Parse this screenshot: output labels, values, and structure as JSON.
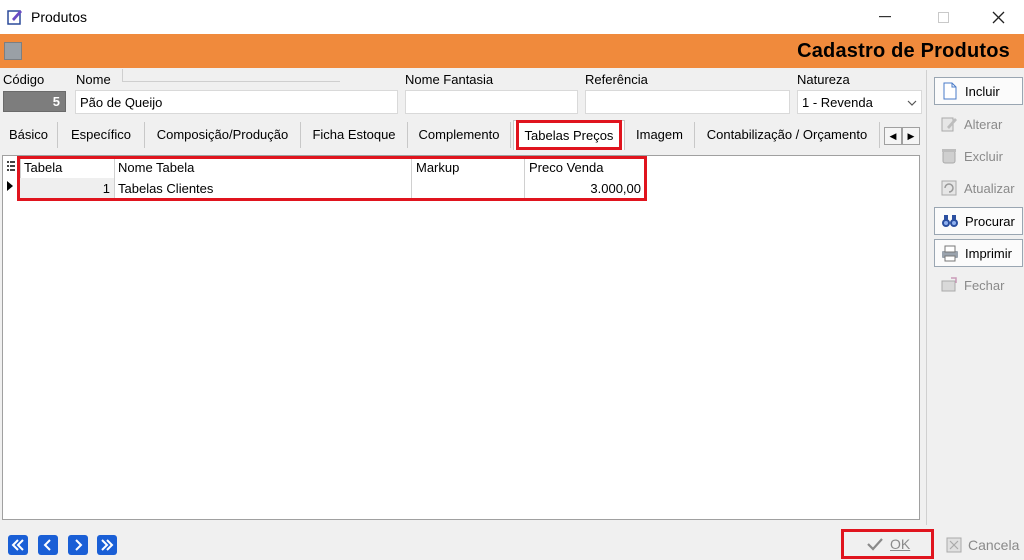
{
  "window": {
    "title": "Produtos"
  },
  "header": {
    "title": "Cadastro de Produtos"
  },
  "fields": {
    "codigo_label": "Código",
    "codigo_value": "5",
    "nome_label": "Nome",
    "nome_value": "Pão de Queijo",
    "nome_fantasia_label": "Nome Fantasia",
    "nome_fantasia_value": "",
    "referencia_label": "Referência",
    "referencia_value": "",
    "natureza_label": "Natureza",
    "natureza_value": "1 - Revenda"
  },
  "tabs": [
    {
      "label": "Básico"
    },
    {
      "label": "Específico"
    },
    {
      "label": "Composição/Produção"
    },
    {
      "label": "Ficha Estoque"
    },
    {
      "label": "Complemento"
    },
    {
      "label": "Tabelas Preços"
    },
    {
      "label": "Imagem"
    },
    {
      "label": "Contabilização / Orçamento"
    }
  ],
  "active_tab": "Tabelas Preços",
  "grid": {
    "columns": [
      "Tabela",
      "Nome Tabela",
      "Markup",
      "Preco Venda"
    ],
    "rows": [
      {
        "tabela": "1",
        "nome_tabela": "Tabelas Clientes",
        "markup": "",
        "preco_venda": "3.000,00"
      }
    ]
  },
  "side_buttons": {
    "incluir": "Incluir",
    "alterar": "Alterar",
    "excluir": "Excluir",
    "atualizar": "Atualizar",
    "procurar": "Procurar",
    "imprimir": "Imprimir",
    "fechar": "Fechar"
  },
  "bottom": {
    "ok": "OK",
    "cancela": "Cancela"
  },
  "colors": {
    "header_orange": "#f08a3c",
    "highlight_red": "#e0141e",
    "nav_blue": "#1a5fd6"
  }
}
